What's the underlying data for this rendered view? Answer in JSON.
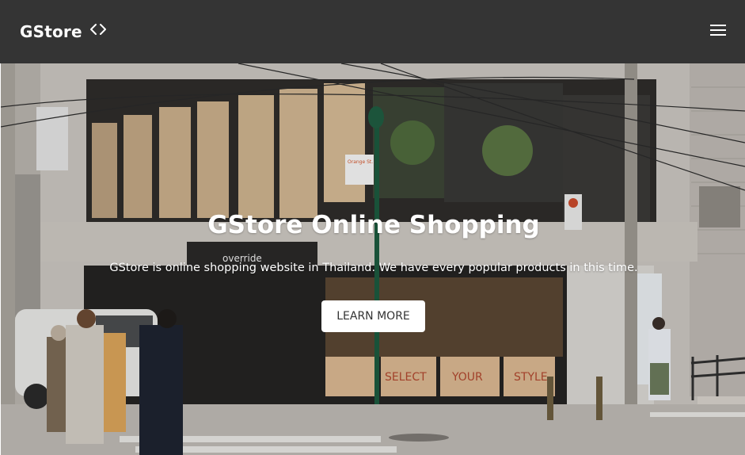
{
  "navbar": {
    "brand": "GStore",
    "brand_icon": "code-icon",
    "menu_icon": "hamburger-menu-icon",
    "background": "#343434"
  },
  "hero": {
    "title": "GStore Online Shopping",
    "description": "GStore is online shopping website in Thailand. We have every popular products in this time.",
    "button_label": "LEARN MORE",
    "image_signs": {
      "shop_sign": "override",
      "window_words": [
        "SELECT",
        "YOUR",
        "STYLE"
      ],
      "street_sign": "Orange St."
    }
  }
}
